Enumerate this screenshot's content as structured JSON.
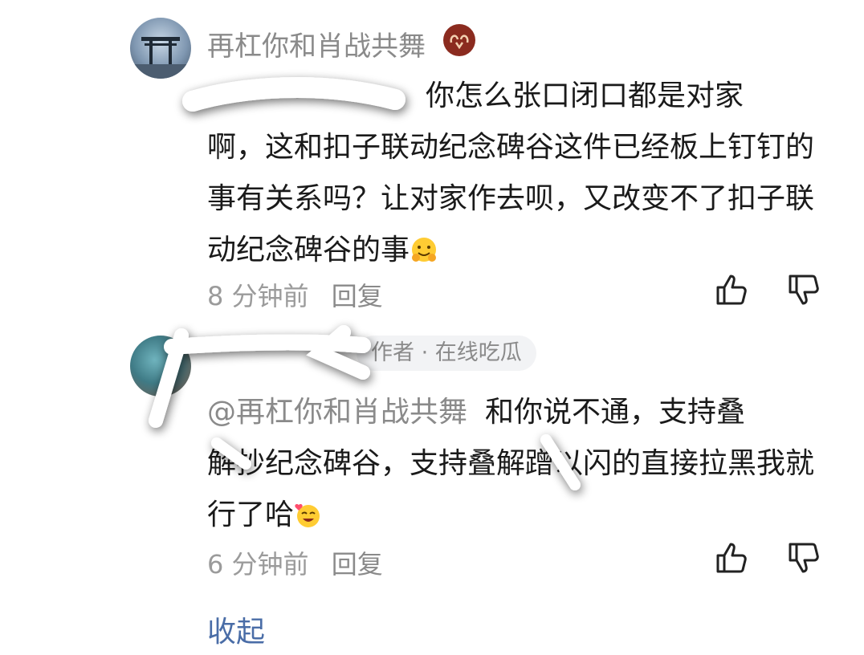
{
  "comments": [
    {
      "username": "再杠你和肖战共舞",
      "mention": "",
      "text_line1": "你怎么张口闭口都是对家",
      "text_rest": "啊，这和扣子联动纪念碑谷这件已经板上钉钉的事有关系吗？让对家作去呗，又改变不了扣子联动纪念碑谷的事",
      "time": "8 分钟前",
      "reply_label": "回复",
      "emoji_icon": "hugging-face-emoji"
    },
    {
      "username": "",
      "author_tag": "作者 · 在线吃瓜",
      "mention": "@再杠你和肖战共舞",
      "text_line1": "和你说不通，支持叠",
      "text_rest": "解抄纪念碑谷，支持叠解蹭以闪的直接拉黑我就行了哈",
      "time": "6 分钟前",
      "reply_label": "回复",
      "emoji_icon": "smiling-face-with-heart-emoji"
    }
  ],
  "collapse_label": "收起",
  "colors": {
    "link": "#4a6da7",
    "muted": "#8a8a8a",
    "text": "#1a1a1a",
    "badge": "#8b2b1f"
  }
}
